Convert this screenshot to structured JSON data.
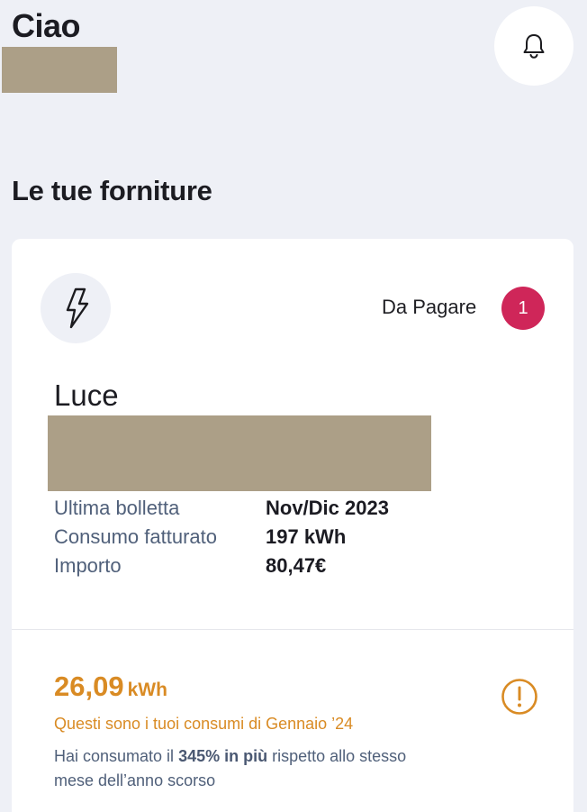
{
  "header": {
    "greeting": "Ciao"
  },
  "icons": {
    "notifications": "bell-icon",
    "supply": "lightning-bolt-icon",
    "alert": "exclamation-circle-icon"
  },
  "colors": {
    "background": "#eef0f6",
    "badge": "#cf2659",
    "warning": "#d98b24",
    "label": "#50607a",
    "redaction": "#ac9f87"
  },
  "section": {
    "title": "Le tue forniture"
  },
  "supply_card": {
    "status_label": "Da Pagare",
    "status_count": "1",
    "type": "Luce",
    "details": [
      {
        "label": "Ultima bolletta",
        "value": "Nov/Dic 2023"
      },
      {
        "label": "Consumo fatturato",
        "value": "197 kWh"
      },
      {
        "label": "Importo",
        "value": "80,47€"
      }
    ],
    "consumption": {
      "value": "26,09",
      "unit": "kWh",
      "note": "Questi sono i tuoi consumi di Gennaio ’24",
      "comparison_prefix": "Hai consumato il ",
      "comparison_highlight": "345% in più",
      "comparison_suffix": " rispetto allo stesso mese dell’anno scorso"
    }
  }
}
